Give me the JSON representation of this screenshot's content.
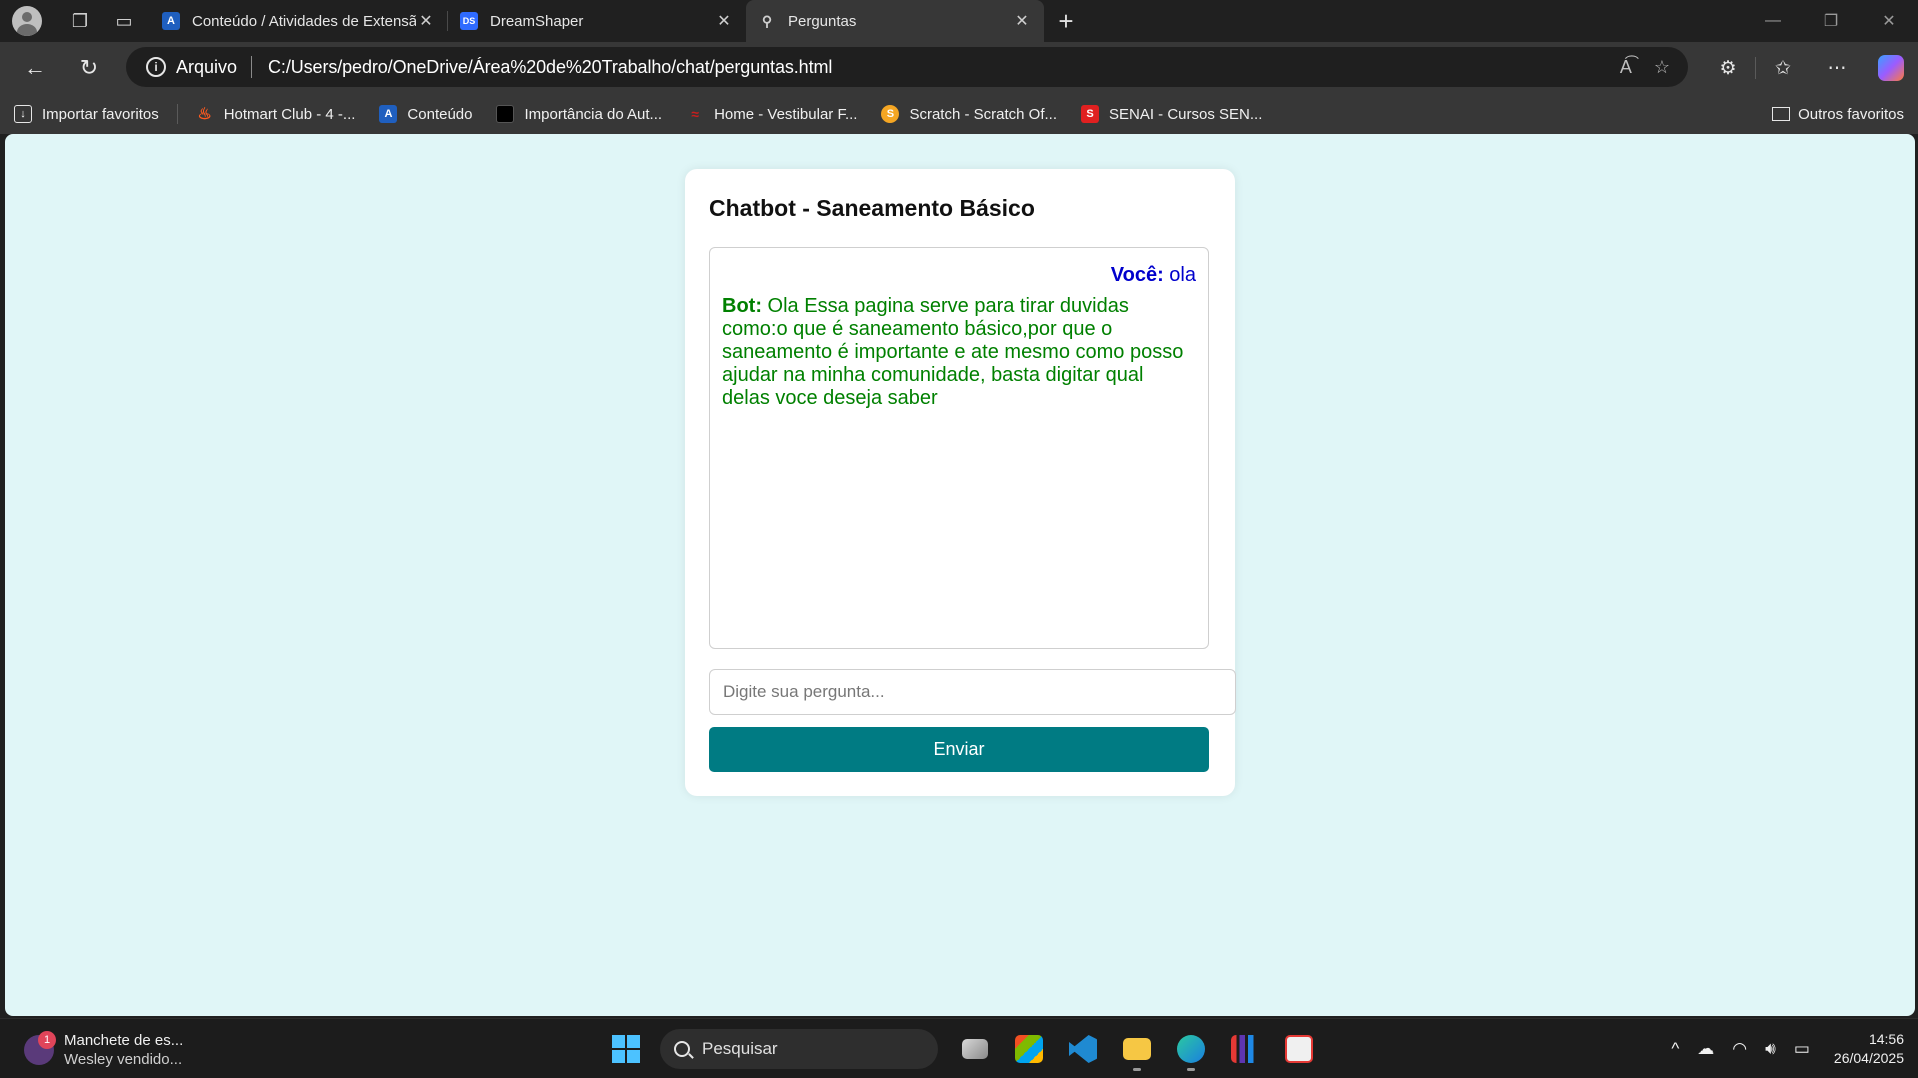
{
  "tabs": [
    {
      "title": "Conteúdo / Atividades de Extensã",
      "favicon_color": "#1f5fbf",
      "favicon_letter": "A"
    },
    {
      "title": "DreamShaper",
      "favicon_color": "#2f6bff",
      "favicon_letter": "DS"
    },
    {
      "title": "Perguntas",
      "favicon_color": "#444444",
      "favicon_letter": ""
    }
  ],
  "address": {
    "scheme_label": "Arquivo",
    "url": "C:/Users/pedro/OneDrive/Área%20de%20Trabalho/chat/perguntas.html"
  },
  "bookmarks": [
    {
      "label": "Importar favoritos",
      "icon": "import-icon",
      "color": "#373737"
    },
    {
      "label": "Hotmart Club - 4 -...",
      "icon": "flame-icon",
      "color": "#ff5a1f"
    },
    {
      "label": "Conteúdo",
      "icon": "a-logo-icon",
      "color": "#1f5fbf"
    },
    {
      "label": "Importância do Aut...",
      "icon": "black-square-icon",
      "color": "#000000"
    },
    {
      "label": "Home - Vestibular F...",
      "icon": "red-logo-icon",
      "color": "#c81e1e"
    },
    {
      "label": "Scratch - Scratch Of...",
      "icon": "scratch-icon",
      "color": "#f5a623"
    },
    {
      "label": "SENAI - Cursos SEN...",
      "icon": "senai-icon",
      "color": "#e02020"
    }
  ],
  "bookmarks_other": "Outros favoritos",
  "chat": {
    "title": "Chatbot - Saneamento Básico",
    "user_prefix": "Você:",
    "user_message": "ola",
    "bot_prefix": "Bot:",
    "bot_message": "Ola Essa pagina serve para tirar duvidas como:o que é saneamento básico,por que o saneamento é importante e ate mesmo como posso ajudar na minha comunidade, basta digitar qual delas voce deseja saber",
    "input_placeholder": "Digite sua pergunta...",
    "input_value": "",
    "send_label": "Enviar",
    "accent_color": "#007b83",
    "user_color": "#0000cc",
    "bot_color": "#008000",
    "background_color": "#e0f6f7"
  },
  "taskbar": {
    "news_badge": "1",
    "news_title": "Manchete de es...",
    "news_subtitle": "Wesley vendido...",
    "search_placeholder": "Pesquisar",
    "time": "14:56",
    "date": "26/04/2025"
  }
}
